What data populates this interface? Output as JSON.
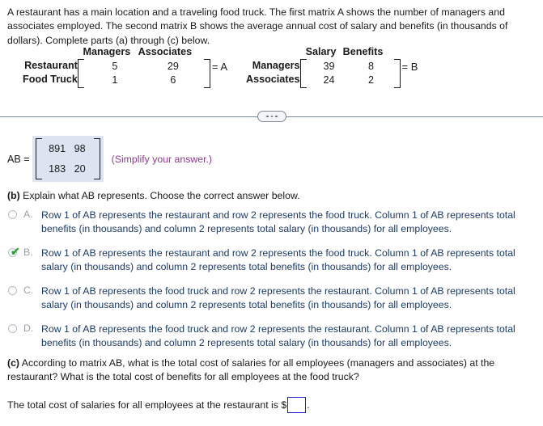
{
  "problem": {
    "stem": "A restaurant has a main location and a traveling food truck. The first matrix A shows the number of managers and associates employed. The second matrix B shows the average annual cost of salary and benefits (in thousands of dollars). Complete parts (a) through (c) below."
  },
  "matrix_a": {
    "name": "= A",
    "col_headers": [
      "Managers",
      "Associates"
    ],
    "row_labels": [
      "Restaurant",
      "Food Truck"
    ],
    "values": [
      [
        "5",
        "29"
      ],
      [
        "1",
        "6"
      ]
    ]
  },
  "matrix_b": {
    "name": "= B",
    "col_headers": [
      "Salary",
      "Benefits"
    ],
    "row_labels": [
      "Managers",
      "Associates"
    ],
    "values": [
      [
        "39",
        "8"
      ],
      [
        "24",
        "2"
      ]
    ]
  },
  "divider": {
    "dots_label": "..."
  },
  "answer_a": {
    "label": "AB =",
    "values": [
      [
        "891",
        "98"
      ],
      [
        "183",
        "20"
      ]
    ],
    "hint": "(Simplify your answer.)"
  },
  "part_b": {
    "marker": "(b)",
    "prompt": " Explain what AB represents. Choose the correct answer below.",
    "options": [
      {
        "letter": "A.",
        "text": "Row 1 of AB represents the restaurant and row 2 represents the food truck. Column 1 of AB represents total benefits (in thousands) and column 2 represents total salary (in thousands) for all employees.",
        "selected": false
      },
      {
        "letter": "B.",
        "text": "Row 1 of AB represents the restaurant and row 2 represents the food truck. Column 1 of AB represents total salary (in thousands) and column 2 represents total benefits (in thousands) for all employees.",
        "selected": true
      },
      {
        "letter": "C.",
        "text": "Row 1 of AB represents the food truck and row 2 represents the restaurant. Column 1 of AB represents total salary (in thousands) and column 2 represents total benefits (in thousands) for all employees.",
        "selected": false
      },
      {
        "letter": "D.",
        "text": "Row 1 of AB represents the food truck and row 2 represents the restaurant. Column 1 of AB represents total benefits (in thousands) and column 2 represents total salary (in thousands) for all employees.",
        "selected": false
      }
    ],
    "check_icon": "✔"
  },
  "part_c": {
    "marker": "(c)",
    "prompt": " According to matrix AB, what is the total cost of salaries for all employees (managers and associates) at the restaurant? What is the total cost of benefits for all employees at the food truck?",
    "answer_prefix": "The total cost of salaries for all employees at the restaurant is $",
    "answer_value": "",
    "answer_suffix": "."
  },
  "colors": {
    "highlight": "#dbe4f0",
    "hint": "#8e3a8e",
    "option_text": "#1b3a6b",
    "input_border": "#1f1fd0",
    "check": "#2aa32a",
    "divider": "#7b879c"
  }
}
